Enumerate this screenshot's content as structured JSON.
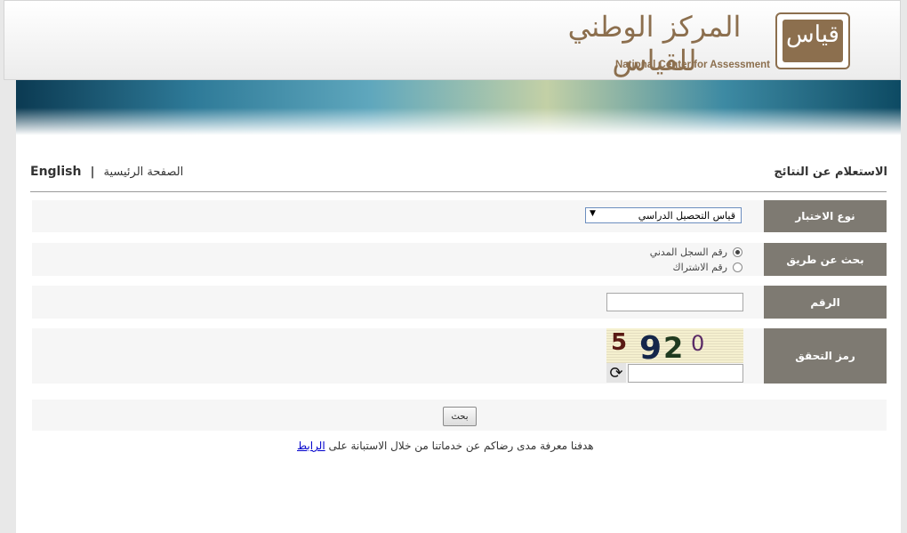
{
  "header": {
    "logo_mark": "قياس",
    "logo_arabic": "المركز الوطني للقياس",
    "logo_english": "National Center for Assessment"
  },
  "page": {
    "title": "الاستعلام عن النتائج",
    "home_link": "الصفحة الرئيسية",
    "separator": "|",
    "english_link": "English"
  },
  "form": {
    "exam_type": {
      "label": "نوع الاختبار",
      "selected": "قياس التحصيل الدراسي"
    },
    "search_by": {
      "label": "بحث عن طريق",
      "options": [
        "رقم السجل المدني",
        "رقم الاشتراك"
      ],
      "selected_index": 0
    },
    "number": {
      "label": "الرقم",
      "value": ""
    },
    "captcha": {
      "label": "رمز التحقق",
      "digits": [
        "5",
        "9",
        "2",
        "0"
      ],
      "value": ""
    },
    "search_button": "بحث"
  },
  "survey": {
    "text": "هدفنا معرفة مدى رضاكم عن خدماتنا من خلال الاستبانة على",
    "link": "الرابط"
  },
  "colors": {
    "brand_brown": "#8c6f4e",
    "label_bg": "#7e7a72",
    "row_bg": "#f6f6f6"
  }
}
